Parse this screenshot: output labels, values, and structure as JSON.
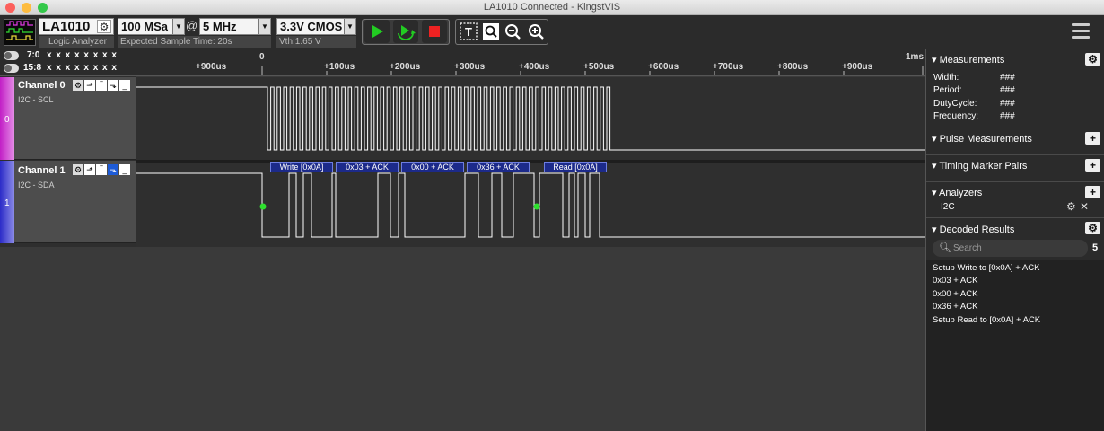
{
  "window": {
    "title": "LA1010 Connected - KingstVIS"
  },
  "toolbar": {
    "device_name": "LA1010",
    "device_sub": "Logic Analyzer",
    "sample_rate": "100 MSa",
    "at": "@",
    "sample_count": "5 MHz",
    "expected_time": "Expected Sample Time: 20s",
    "voltage": "3.3V CMOS",
    "vth": "Vth:1.65 V"
  },
  "groups": [
    {
      "label": "7:0",
      "values": "x x x x x x x x"
    },
    {
      "label": "15:8",
      "values": "x x x x x x x x"
    }
  ],
  "ruler": {
    "ticks": [
      "+900us",
      "0",
      "+100us",
      "+200us",
      "+300us",
      "+400us",
      "+500us",
      "+600us",
      "+700us",
      "+800us",
      "+900us",
      "1ms"
    ]
  },
  "channels": [
    {
      "name": "Channel 0",
      "sub": "I2C - SCL",
      "num": "0",
      "color": "#c21fc6"
    },
    {
      "name": "Channel 1",
      "sub": "I2C - SDA",
      "num": "1",
      "color": "#2b2bc8"
    }
  ],
  "annotations": [
    "Write [0x0A]",
    "0x03 + ACK",
    "0x00 + ACK",
    "0x36 + ACK",
    "Read [0x0A]"
  ],
  "measurements": {
    "title": "Measurements",
    "rows": [
      {
        "label": "Width:",
        "value": "###"
      },
      {
        "label": "Period:",
        "value": "###"
      },
      {
        "label": "DutyCycle:",
        "value": "###"
      },
      {
        "label": "Frequency:",
        "value": "###"
      }
    ]
  },
  "panels": {
    "pulse": "Pulse Measurements",
    "timing": "Timing Marker Pairs",
    "analyzers": "Analyzers",
    "analyzer_item": "I2C",
    "decoded": "Decoded Results",
    "search_placeholder": "Search",
    "result_count": "5"
  },
  "decoded_results": [
    "Setup Write to [0x0A] + ACK",
    "0x03 + ACK",
    "0x00 + ACK",
    "0x36 + ACK",
    "Setup Read to [0x0A] + ACK"
  ]
}
